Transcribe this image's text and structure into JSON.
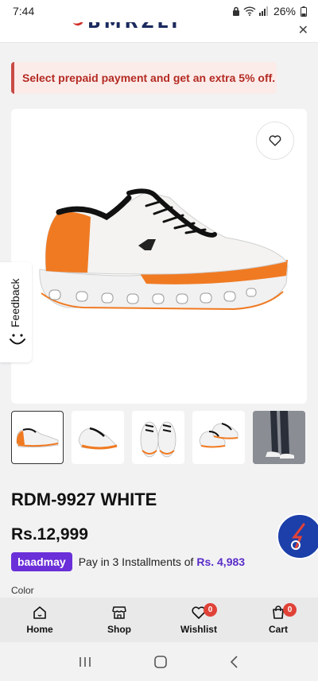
{
  "status_bar": {
    "time": "7:44",
    "battery": "26%"
  },
  "header": {
    "logo_text": "BMRZLT"
  },
  "promo": {
    "text": "Select prepaid payment and get an extra 5% off."
  },
  "feedback": {
    "label": "Feedback"
  },
  "product": {
    "title": "RDM-9927 WHITE",
    "price": "Rs.12,999",
    "installment_provider": "baadmay",
    "installment_text": "Pay in 3 Installments of",
    "installment_amount": "Rs. 4,983",
    "color_label": "Color"
  },
  "thumbnails": [
    "side-view",
    "angle-view",
    "front-view",
    "pair-view",
    "worn-view"
  ],
  "bottom_nav": [
    {
      "label": "Home",
      "icon": "home-icon"
    },
    {
      "label": "Shop",
      "icon": "shop-icon"
    },
    {
      "label": "Wishlist",
      "icon": "heart-icon",
      "badge": "0"
    },
    {
      "label": "Cart",
      "icon": "cart-icon",
      "badge": "0"
    }
  ],
  "colors": {
    "accent_orange": "#f07a22",
    "promo_red": "#b42a22",
    "baadmay_purple": "#6a2fd8",
    "fab_blue": "#1c3faa",
    "badge_red": "#e04238"
  }
}
